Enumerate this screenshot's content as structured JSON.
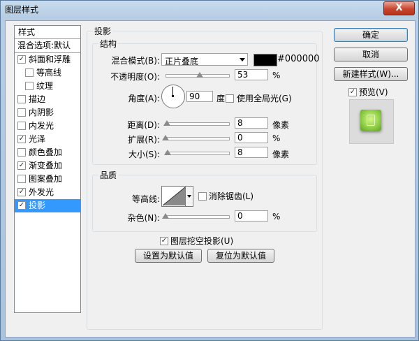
{
  "window": {
    "title": "图层样式",
    "close_symbol": "X"
  },
  "style_list": {
    "header": "样式",
    "items": [
      {
        "label": "混合选项:默认",
        "checkbox": false,
        "checked": false,
        "indent": false
      },
      {
        "label": "斜面和浮雕",
        "checkbox": true,
        "checked": true,
        "indent": false
      },
      {
        "label": "等高线",
        "checkbox": true,
        "checked": false,
        "indent": true
      },
      {
        "label": "纹理",
        "checkbox": true,
        "checked": false,
        "indent": true
      },
      {
        "label": "描边",
        "checkbox": true,
        "checked": false,
        "indent": false
      },
      {
        "label": "内阴影",
        "checkbox": true,
        "checked": false,
        "indent": false
      },
      {
        "label": "内发光",
        "checkbox": true,
        "checked": false,
        "indent": false
      },
      {
        "label": "光泽",
        "checkbox": true,
        "checked": true,
        "indent": false
      },
      {
        "label": "颜色叠加",
        "checkbox": true,
        "checked": false,
        "indent": false
      },
      {
        "label": "渐变叠加",
        "checkbox": true,
        "checked": true,
        "indent": false
      },
      {
        "label": "图案叠加",
        "checkbox": true,
        "checked": false,
        "indent": false
      },
      {
        "label": "外发光",
        "checkbox": true,
        "checked": true,
        "indent": false
      },
      {
        "label": "投影",
        "checkbox": true,
        "checked": true,
        "indent": false,
        "selected": true
      }
    ]
  },
  "panel": {
    "title": "投影",
    "structure": {
      "title": "结构",
      "blend_mode_label": "混合模式(B):",
      "blend_mode_value": "正片叠底",
      "color_hex": "#000000",
      "opacity_label": "不透明度(O):",
      "opacity_value": "53",
      "opacity_fraction": 0.53,
      "percent": "%",
      "angle_label": "角度(A):",
      "angle_value": "90",
      "degree_unit": "度",
      "global_light_label": "使用全局光(G)",
      "global_light_checked": false,
      "distance_label": "距离(D):",
      "distance_value": "8",
      "distance_fraction": 0.027,
      "spread_label": "扩展(R):",
      "spread_value": "0",
      "spread_fraction": 0,
      "size_label": "大小(S):",
      "size_value": "8",
      "size_fraction": 0.032,
      "pixel_unit": "像素"
    },
    "quality": {
      "title": "品质",
      "contour_label": "等高线:",
      "antialias_label": "消除锯齿(L)",
      "antialias_checked": false,
      "noise_label": "杂色(N):",
      "noise_value": "0",
      "noise_fraction": 0
    },
    "knockout_label": "图层挖空投影(U)",
    "knockout_checked": true,
    "make_default_label": "设置为默认值",
    "reset_default_label": "复位为默认值"
  },
  "buttons": {
    "ok": "确定",
    "cancel": "取消",
    "new_style": "新建样式(W)...",
    "preview_label": "预览(V)",
    "preview_checked": true
  },
  "check_symbol": "✓"
}
